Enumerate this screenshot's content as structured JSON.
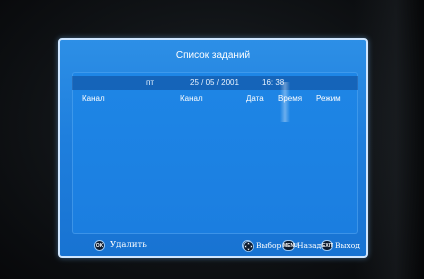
{
  "window": {
    "title": "Список заданий"
  },
  "datetime": {
    "day": "пт",
    "date": "25 / 05 / 2001",
    "time": "16: 38"
  },
  "columns": {
    "channel1": "Канал",
    "channel2": "Канал",
    "date": "Дата",
    "time": "Время",
    "mode": "Режим"
  },
  "rows": [],
  "footer": {
    "ok_key": "OK",
    "ok_label": "Удалить",
    "nav_label": "Выбор",
    "menu_key": "MENU",
    "menu_label": "Назад",
    "exit_key": "EXIT",
    "exit_label": "Выход"
  },
  "colors": {
    "window_bg": "#2d8fe6",
    "panel_bg": "#1e86e6",
    "border": "#cfe6ff"
  },
  "icons": {
    "nav": "dpad-icon"
  }
}
